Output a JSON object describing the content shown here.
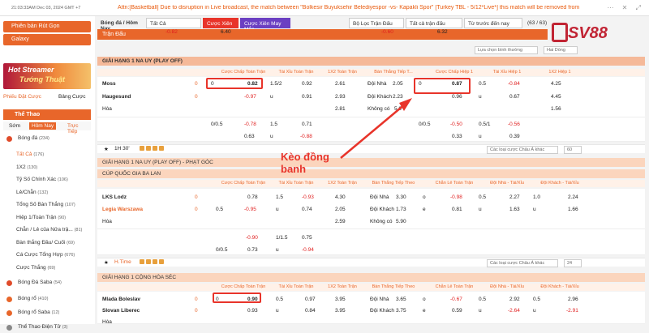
{
  "top": {
    "clock": "21:03:33AM Dec 03, 2024 GMT +7",
    "ticker": "Attn:[Basketball] Due to disruption in Live broadcast, the match between \"Bolkesir Buyuksehir Belediyespor -vs- Kapakli Spor\" [Turkey TBL - 5/12*Live*] this match will be removed from"
  },
  "sidebar": {
    "btn1": "Phiên bản Rút Gọn",
    "btn2": "Galaxy",
    "banner1": "Hot Streamer",
    "banner2": "Tướng Thuật",
    "filter1": "Phiếu Đặt Cược",
    "filter2": "Bảng Cược",
    "sports_title": "Thể Thao",
    "tabs": [
      "Sớm",
      "Hôm Nay",
      "Trực Tiếp"
    ],
    "football": {
      "label": "Bóng đá",
      "count": "(234)"
    },
    "sub": [
      {
        "label": "Tất Cả",
        "count": "(176)"
      },
      {
        "label": "1X2",
        "count": "(130)"
      },
      {
        "label": "Tỷ Số Chính Xác",
        "count": "(106)"
      },
      {
        "label": "Lẻ/Chẵn",
        "count": "(132)"
      },
      {
        "label": "Tổng Số Bàn Thắng",
        "count": "(107)"
      },
      {
        "label": "Hiệp 1/Toàn Trận",
        "count": "(90)"
      },
      {
        "label": "Chẵn / Lẻ của Nửa trậ...",
        "count": "(81)"
      },
      {
        "label": "Bàn thắng Đầu/ Cuối",
        "count": "(69)"
      },
      {
        "label": "Cá Cược Tổng Hợp",
        "count": "(676)"
      },
      {
        "label": "Cược Thắng",
        "count": "(69)"
      }
    ],
    "sports": [
      {
        "label": "Bóng Đá Saba",
        "count": "(54)"
      },
      {
        "label": "Bóng rổ",
        "count": "(410)"
      },
      {
        "label": "Bóng rổ Saba",
        "count": "(12)"
      },
      {
        "label": "Thể Thao Điện Tử",
        "count": "(3)"
      }
    ]
  },
  "filters": {
    "sport": "Bóng đá / Hôm Nay",
    "all": "Tất Cả",
    "parlay": "Cược Xiên",
    "parlay_lucky": "Cược Xiên May Mắn",
    "league_filter": "Bộ Lọc Trận Đấu",
    "all_matches": "Tất cả trận đấu",
    "sort": "Từ trước đến nay",
    "count": "(63 / 63)",
    "odds_type": "Giá Gi"
  },
  "top_odds": [
    "-0.82",
    "6.40",
    "-0.60",
    "6.32"
  ],
  "logo": "SV88",
  "matches_title": "Trận Đấu",
  "sort_label": "Lựa chọn bình thường",
  "two_label": "Hai Dòng",
  "headers": [
    "Cược Chấp Toàn Trận",
    "Tài Xỉu Toàn Trận",
    "1X2 Toàn Trận",
    "Bàn Thắng Tiếp T...",
    "Cược Chấp Hiệp 1",
    "Tài Xỉu Hiệp 1",
    "1X2 Hiệp 1"
  ],
  "headers2": [
    "Cược Chấp Toàn Trận",
    "Tài Xỉu Toàn Trận",
    "1X2 Toàn Trận",
    "Bàn Thắng Tiếp Theo",
    "Chẵn Lẻ Toàn Trận",
    "Đội Nhà - Tài/Xỉu",
    "Đội Khách - Tài/Xỉu"
  ],
  "league1": "GIẢI HẠNG 1 NA UY (PLAY OFF)",
  "m1": {
    "home": "Moss",
    "away": "Haugesund",
    "draw": "Hòa",
    "score_h": "0",
    "score_a": "0",
    "r1": [
      "0",
      "0.82",
      "1.5/2",
      "0.92",
      "2.61",
      "Đội Nhà",
      "2.05",
      "0",
      "0.87",
      "0.5",
      "-0.84",
      "4.25"
    ],
    "r2": [
      "-0.97",
      "u",
      "0.91",
      "2.93",
      "Đội Khách",
      "2.23",
      "0.96",
      "u",
      "0.67",
      "4.45"
    ],
    "r3": [
      "2.81",
      "Không có",
      "5.0",
      "1.56"
    ],
    "r4": [
      "0/0.5",
      "-0.78",
      "1.5",
      "0.71",
      "0/0.5",
      "-0.50",
      "0.5/1",
      "-0.56"
    ],
    "r5": [
      "0.63",
      "u",
      "-0.88",
      "0.33",
      "u",
      "0.39"
    ]
  },
  "time1": "1H 30'",
  "odds_select": "Các loại cược Châu Á khác",
  "page_sel": "60",
  "league2": "GIẢI HẠNG 1 NA UY (PLAY OFF) - PHẠT GÓC",
  "league3": "CÚP QUỐC GIA BA LAN",
  "m2": {
    "home": "LKS Lodz",
    "away": "Legia Warszawa",
    "draw": "Hòa",
    "score_h": "0",
    "score_a": "0",
    "r1": [
      "0.78",
      "1.5",
      "-0.93",
      "4.30",
      "Đội Nhà",
      "3.30",
      "o",
      "-0.98",
      "0.5",
      "2.27",
      "1.0",
      "2.24"
    ],
    "r2": [
      "0.5",
      "-0.95",
      "u",
      "0.74",
      "2.05",
      "Đội Khách",
      "1.73",
      "e",
      "0.81",
      "u",
      "1.63",
      "u",
      "1.66"
    ],
    "r3": [
      "2.59",
      "Không có",
      "5.90"
    ],
    "r4": [
      "-0.90",
      "1/1.5",
      "0.75"
    ],
    "r5": [
      "0/0.5",
      "0.73",
      "u",
      "-0.94"
    ]
  },
  "time2": "H.Time",
  "page_sel2": "24",
  "league4": "GIẢI HẠNG 1 CỘNG HÒA SÉC",
  "m3": {
    "home": "Mlada Boleslav",
    "away": "Slovan Liberec",
    "draw": "Hòa",
    "score_h": "0",
    "score_a": "0",
    "r1": [
      "0",
      "0.90",
      "0.5",
      "0.97",
      "3.95",
      "Đội Nhà",
      "3.65",
      "o",
      "-0.67",
      "0.5",
      "2.92",
      "0.5",
      "2.96"
    ],
    "r2": [
      "0.93",
      "u",
      "0.84",
      "3.95",
      "Đội Khách",
      "3.75",
      "e",
      "0.59",
      "u",
      "-2.64",
      "u",
      "-2.91"
    ]
  },
  "annotation": "Kèo đồng banh"
}
